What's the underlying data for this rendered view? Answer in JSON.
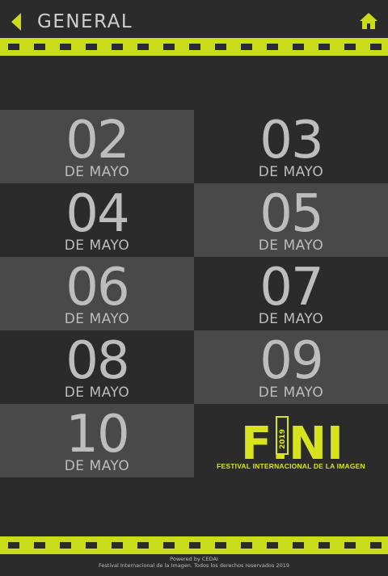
{
  "header": {
    "title": "GENERAL",
    "back_icon": "back-arrow-icon",
    "home_icon": "home-icon"
  },
  "colors": {
    "accent": "#c8dc1a",
    "background": "#2b2b2b",
    "cell_light": "#494949",
    "text": "#bdbdbd"
  },
  "dates": [
    {
      "day": "02",
      "month": "DE MAYO"
    },
    {
      "day": "03",
      "month": "DE MAYO"
    },
    {
      "day": "04",
      "month": "DE MAYO"
    },
    {
      "day": "05",
      "month": "DE MAYO"
    },
    {
      "day": "06",
      "month": "DE MAYO"
    },
    {
      "day": "07",
      "month": "DE MAYO"
    },
    {
      "day": "08",
      "month": "DE MAYO"
    },
    {
      "day": "09",
      "month": "DE MAYO"
    },
    {
      "day": "10",
      "month": "DE MAYO"
    }
  ],
  "logo": {
    "text": "FINI",
    "year": "2019",
    "caption": "FESTIVAL INTERNACIONAL DE LA IMAGEN"
  },
  "footer": {
    "powered_by": "Powered by CEDAI",
    "copyright": "Festival Internacional de la Imagen. Todos los derechos reservados 2019"
  }
}
